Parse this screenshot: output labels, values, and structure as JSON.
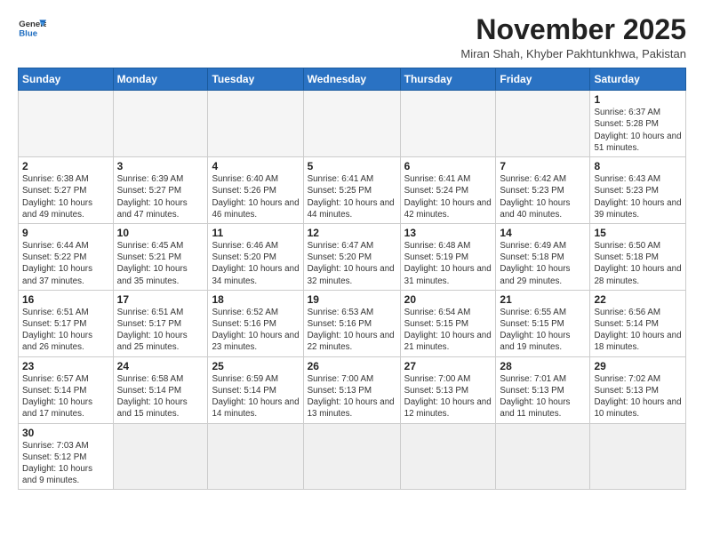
{
  "header": {
    "logo_general": "General",
    "logo_blue": "Blue",
    "title": "November 2025",
    "subtitle": "Miran Shah, Khyber Pakhtunkhwa, Pakistan"
  },
  "weekdays": [
    "Sunday",
    "Monday",
    "Tuesday",
    "Wednesday",
    "Thursday",
    "Friday",
    "Saturday"
  ],
  "weeks": [
    [
      {
        "day": "",
        "info": ""
      },
      {
        "day": "",
        "info": ""
      },
      {
        "day": "",
        "info": ""
      },
      {
        "day": "",
        "info": ""
      },
      {
        "day": "",
        "info": ""
      },
      {
        "day": "",
        "info": ""
      },
      {
        "day": "1",
        "info": "Sunrise: 6:37 AM\nSunset: 5:28 PM\nDaylight: 10 hours and 51 minutes."
      }
    ],
    [
      {
        "day": "2",
        "info": "Sunrise: 6:38 AM\nSunset: 5:27 PM\nDaylight: 10 hours and 49 minutes."
      },
      {
        "day": "3",
        "info": "Sunrise: 6:39 AM\nSunset: 5:27 PM\nDaylight: 10 hours and 47 minutes."
      },
      {
        "day": "4",
        "info": "Sunrise: 6:40 AM\nSunset: 5:26 PM\nDaylight: 10 hours and 46 minutes."
      },
      {
        "day": "5",
        "info": "Sunrise: 6:41 AM\nSunset: 5:25 PM\nDaylight: 10 hours and 44 minutes."
      },
      {
        "day": "6",
        "info": "Sunrise: 6:41 AM\nSunset: 5:24 PM\nDaylight: 10 hours and 42 minutes."
      },
      {
        "day": "7",
        "info": "Sunrise: 6:42 AM\nSunset: 5:23 PM\nDaylight: 10 hours and 40 minutes."
      },
      {
        "day": "8",
        "info": "Sunrise: 6:43 AM\nSunset: 5:23 PM\nDaylight: 10 hours and 39 minutes."
      }
    ],
    [
      {
        "day": "9",
        "info": "Sunrise: 6:44 AM\nSunset: 5:22 PM\nDaylight: 10 hours and 37 minutes."
      },
      {
        "day": "10",
        "info": "Sunrise: 6:45 AM\nSunset: 5:21 PM\nDaylight: 10 hours and 35 minutes."
      },
      {
        "day": "11",
        "info": "Sunrise: 6:46 AM\nSunset: 5:20 PM\nDaylight: 10 hours and 34 minutes."
      },
      {
        "day": "12",
        "info": "Sunrise: 6:47 AM\nSunset: 5:20 PM\nDaylight: 10 hours and 32 minutes."
      },
      {
        "day": "13",
        "info": "Sunrise: 6:48 AM\nSunset: 5:19 PM\nDaylight: 10 hours and 31 minutes."
      },
      {
        "day": "14",
        "info": "Sunrise: 6:49 AM\nSunset: 5:18 PM\nDaylight: 10 hours and 29 minutes."
      },
      {
        "day": "15",
        "info": "Sunrise: 6:50 AM\nSunset: 5:18 PM\nDaylight: 10 hours and 28 minutes."
      }
    ],
    [
      {
        "day": "16",
        "info": "Sunrise: 6:51 AM\nSunset: 5:17 PM\nDaylight: 10 hours and 26 minutes."
      },
      {
        "day": "17",
        "info": "Sunrise: 6:51 AM\nSunset: 5:17 PM\nDaylight: 10 hours and 25 minutes."
      },
      {
        "day": "18",
        "info": "Sunrise: 6:52 AM\nSunset: 5:16 PM\nDaylight: 10 hours and 23 minutes."
      },
      {
        "day": "19",
        "info": "Sunrise: 6:53 AM\nSunset: 5:16 PM\nDaylight: 10 hours and 22 minutes."
      },
      {
        "day": "20",
        "info": "Sunrise: 6:54 AM\nSunset: 5:15 PM\nDaylight: 10 hours and 21 minutes."
      },
      {
        "day": "21",
        "info": "Sunrise: 6:55 AM\nSunset: 5:15 PM\nDaylight: 10 hours and 19 minutes."
      },
      {
        "day": "22",
        "info": "Sunrise: 6:56 AM\nSunset: 5:14 PM\nDaylight: 10 hours and 18 minutes."
      }
    ],
    [
      {
        "day": "23",
        "info": "Sunrise: 6:57 AM\nSunset: 5:14 PM\nDaylight: 10 hours and 17 minutes."
      },
      {
        "day": "24",
        "info": "Sunrise: 6:58 AM\nSunset: 5:14 PM\nDaylight: 10 hours and 15 minutes."
      },
      {
        "day": "25",
        "info": "Sunrise: 6:59 AM\nSunset: 5:14 PM\nDaylight: 10 hours and 14 minutes."
      },
      {
        "day": "26",
        "info": "Sunrise: 7:00 AM\nSunset: 5:13 PM\nDaylight: 10 hours and 13 minutes."
      },
      {
        "day": "27",
        "info": "Sunrise: 7:00 AM\nSunset: 5:13 PM\nDaylight: 10 hours and 12 minutes."
      },
      {
        "day": "28",
        "info": "Sunrise: 7:01 AM\nSunset: 5:13 PM\nDaylight: 10 hours and 11 minutes."
      },
      {
        "day": "29",
        "info": "Sunrise: 7:02 AM\nSunset: 5:13 PM\nDaylight: 10 hours and 10 minutes."
      }
    ],
    [
      {
        "day": "30",
        "info": "Sunrise: 7:03 AM\nSunset: 5:12 PM\nDaylight: 10 hours and 9 minutes."
      },
      {
        "day": "",
        "info": ""
      },
      {
        "day": "",
        "info": ""
      },
      {
        "day": "",
        "info": ""
      },
      {
        "day": "",
        "info": ""
      },
      {
        "day": "",
        "info": ""
      },
      {
        "day": "",
        "info": ""
      }
    ]
  ]
}
